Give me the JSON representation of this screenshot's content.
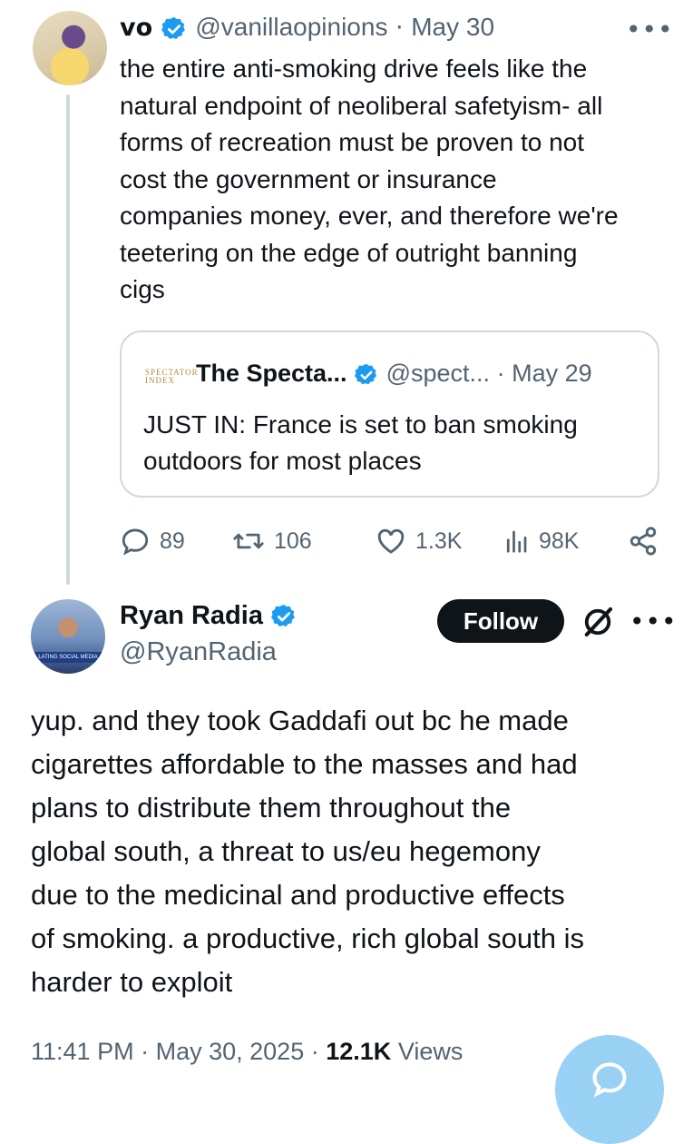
{
  "tweet1": {
    "name": "vo",
    "handle": "@vanillaopinions",
    "date": "May 30",
    "text": "the entire anti-smoking drive feels like the\nnatural endpoint of neoliberal safetyism- all\nforms of recreation must be proven to not\ncost the government or insurance\ncompanies money, ever, and therefore we're\nteetering on the edge of outright banning\ncigs",
    "quote": {
      "logo": "SPECTATOR\nINDEX",
      "name": "The Specta...",
      "handle": "@spect...",
      "date": "May 29",
      "text": "JUST IN: France is set to ban smoking\noutdoors for most places"
    },
    "actions": {
      "replies": "89",
      "reposts": "106",
      "likes": "1.3K",
      "views": "98K"
    }
  },
  "tweet2": {
    "name": "Ryan Radia",
    "handle": "@RyanRadia",
    "follow_label": "Follow",
    "avatar_banner": "LATING SOCIAL MEDIA",
    "text": "yup. and they took Gaddafi out bc he made\ncigarettes affordable to the masses and had\nplans to distribute them throughout the\nglobal south, a threat to us/eu hegemony\ndue to the medicinal and productive effects\nof smoking. a productive, rich global south is\nharder to exploit",
    "time": "11:41 PM",
    "date": "May 30, 2025",
    "views_count": "12.1K",
    "views_label": "Views"
  },
  "separator": "·",
  "more_glyph": "•••",
  "colors": {
    "verified": "#1d9bf0",
    "text": "#0f1419",
    "muted": "#536471",
    "border": "#cfd9de",
    "follow_bg": "#0f1419",
    "fab": "#8ecdf5"
  },
  "icons": [
    "verified-badge-icon",
    "more-icon",
    "reply-icon",
    "repost-icon",
    "like-icon",
    "views-icon",
    "share-icon",
    "grok-icon",
    "compose-icon"
  ]
}
